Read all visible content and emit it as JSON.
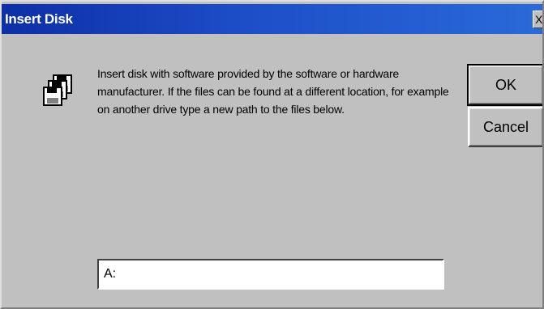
{
  "window": {
    "title": "Insert Disk",
    "close_glyph": "X"
  },
  "icon": "floppy-disks-icon",
  "message": "Insert disk with software provided by the software or hardware manufacturer.  If the files can be found at a different location, for example on another drive type a new path to the files below.",
  "buttons": {
    "ok_label": "OK",
    "cancel_label": "Cancel"
  },
  "path_input": {
    "value": "A:"
  },
  "colors": {
    "face": "#c0c0c0",
    "titlebar_start": "#0d2fa7",
    "titlebar_end": "#2a6ad8",
    "title_text": "#ffffff"
  }
}
